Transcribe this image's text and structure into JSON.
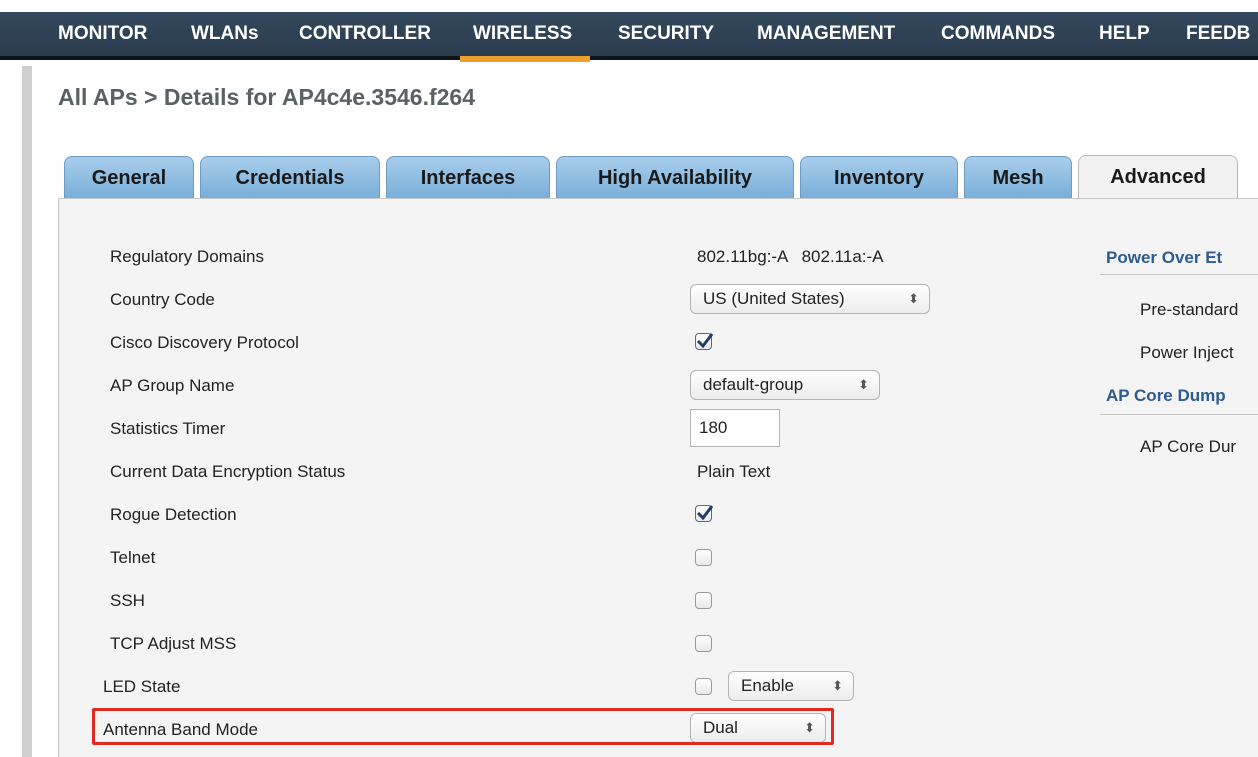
{
  "nav": {
    "items": [
      {
        "label": "MONITOR"
      },
      {
        "label": "WLANs"
      },
      {
        "label": "CONTROLLER"
      },
      {
        "label": "WIRELESS",
        "active": true
      },
      {
        "label": "SECURITY"
      },
      {
        "label": "MANAGEMENT"
      },
      {
        "label": "COMMANDS"
      },
      {
        "label": "HELP"
      },
      {
        "label": "FEEDB"
      }
    ],
    "active_color": "#f0a02a",
    "bar_color": "#2f4356"
  },
  "breadcrumb": "All APs > Details for AP4c4e.3546.f264",
  "tabs": [
    {
      "label": "General"
    },
    {
      "label": "Credentials"
    },
    {
      "label": "Interfaces"
    },
    {
      "label": "High Availability"
    },
    {
      "label": "Inventory"
    },
    {
      "label": "Mesh"
    },
    {
      "label": "Advanced",
      "active": true
    }
  ],
  "form": {
    "regulatory_domains": {
      "label": "Regulatory Domains",
      "value": "802.11bg:-A   802.11a:-A"
    },
    "country_code": {
      "label": "Country Code",
      "value": "US (United States)"
    },
    "cdp": {
      "label": "Cisco Discovery Protocol",
      "checked": true
    },
    "ap_group_name": {
      "label": "AP Group Name",
      "value": "default-group"
    },
    "statistics_timer": {
      "label": "Statistics Timer",
      "value": "180"
    },
    "encryption_status": {
      "label": "Current Data Encryption Status",
      "value": "Plain Text"
    },
    "rogue_detection": {
      "label": "Rogue Detection",
      "checked": true
    },
    "telnet": {
      "label": "Telnet",
      "checked": false
    },
    "ssh": {
      "label": "SSH",
      "checked": false
    },
    "tcp_adjust_mss": {
      "label": "TCP Adjust MSS",
      "checked": false
    },
    "led_state": {
      "label": "LED State",
      "checked": false,
      "value": "Enable"
    },
    "antenna_band_mode": {
      "label": "Antenna Band Mode",
      "value": "Dual"
    }
  },
  "right": {
    "poe_heading": "Power Over Et",
    "pre_standard": "Pre-standard",
    "power_injector": "Power Inject",
    "core_dump_heading": "AP Core Dump",
    "core_dump_item": "AP Core Dur"
  },
  "colors": {
    "highlight": "#e02a20",
    "tab_blue": "#8fbfe3",
    "heading_blue": "#2c5c8f"
  }
}
